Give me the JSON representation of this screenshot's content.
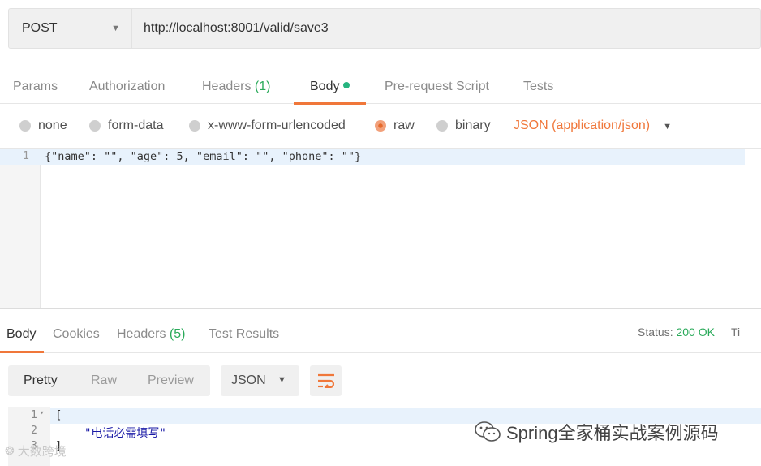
{
  "request": {
    "method": "POST",
    "url": "http://localhost:8001/valid/save3"
  },
  "request_tabs": [
    {
      "label": "Params"
    },
    {
      "label": "Authorization"
    },
    {
      "label": "Headers ",
      "count": "(1)"
    },
    {
      "label": "Body",
      "active": true
    },
    {
      "label": "Pre-request Script"
    },
    {
      "label": "Tests"
    }
  ],
  "body_types": {
    "none": "none",
    "form_data": "form-data",
    "urlencoded": "x-www-form-urlencoded",
    "raw": "raw",
    "binary": "binary",
    "selected": "raw",
    "content_type": "JSON (application/json)"
  },
  "editor": {
    "line_number": "1",
    "code": "{\"name\": \"\", \"age\": 5, \"email\": \"\", \"phone\": \"\"}"
  },
  "response_tabs": [
    {
      "label": "Body",
      "active": true
    },
    {
      "label": "Cookies"
    },
    {
      "label": "Headers ",
      "count": "(5)"
    },
    {
      "label": "Test Results"
    }
  ],
  "status": {
    "label": "Status: ",
    "value": "200 OK",
    "extra": "Ti"
  },
  "response_toolbar": {
    "views": [
      "Pretty",
      "Raw",
      "Preview"
    ],
    "active_view": "Pretty",
    "format": "JSON"
  },
  "response_body": {
    "lines": [
      {
        "number": "1",
        "text": "["
      },
      {
        "number": "2",
        "text": "\"电话必需填写\""
      },
      {
        "number": "3",
        "text": "]"
      }
    ]
  },
  "watermarks": {
    "right": "Spring全家桶实战案例源码",
    "left": "大数跨境"
  },
  "colors": {
    "accent": "#f0773a",
    "success": "#2aaa5a",
    "active_dot": "#26b47f"
  }
}
